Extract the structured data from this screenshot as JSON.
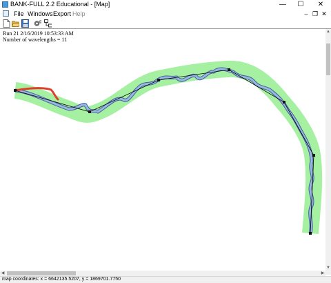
{
  "window": {
    "title": "BANK-FULL 2.2 Educational - [Map]",
    "minimize_glyph": "—",
    "maximize_glyph": "☐",
    "close_glyph": "✕"
  },
  "menu": {
    "items": [
      "File",
      "Windows",
      "Export",
      "Help"
    ],
    "child_minimize_glyph": "–",
    "child_restore_glyph": "❐",
    "child_close_glyph": "✕"
  },
  "toolbar": {
    "icons": [
      "new-document-icon",
      "open-folder-icon",
      "save-disk-icon",
      "settings-gears-icon",
      "network-map-icon"
    ]
  },
  "map": {
    "run_info": "Run 21 2/16/2019 10:53:33 AM",
    "wavelength_info": "Number of wavelengths = 11",
    "colors": {
      "meander_belt": "#a6f0a1",
      "channel_outline": "#3f5f9c",
      "channel_fill": "#9ab8dd",
      "highlight_segment": "#e0402a",
      "centerline": "#000000",
      "vertex": "#111111"
    }
  },
  "status": {
    "coords": "map coordinates: x = 6642135.5207, y = 1869701.7750"
  }
}
